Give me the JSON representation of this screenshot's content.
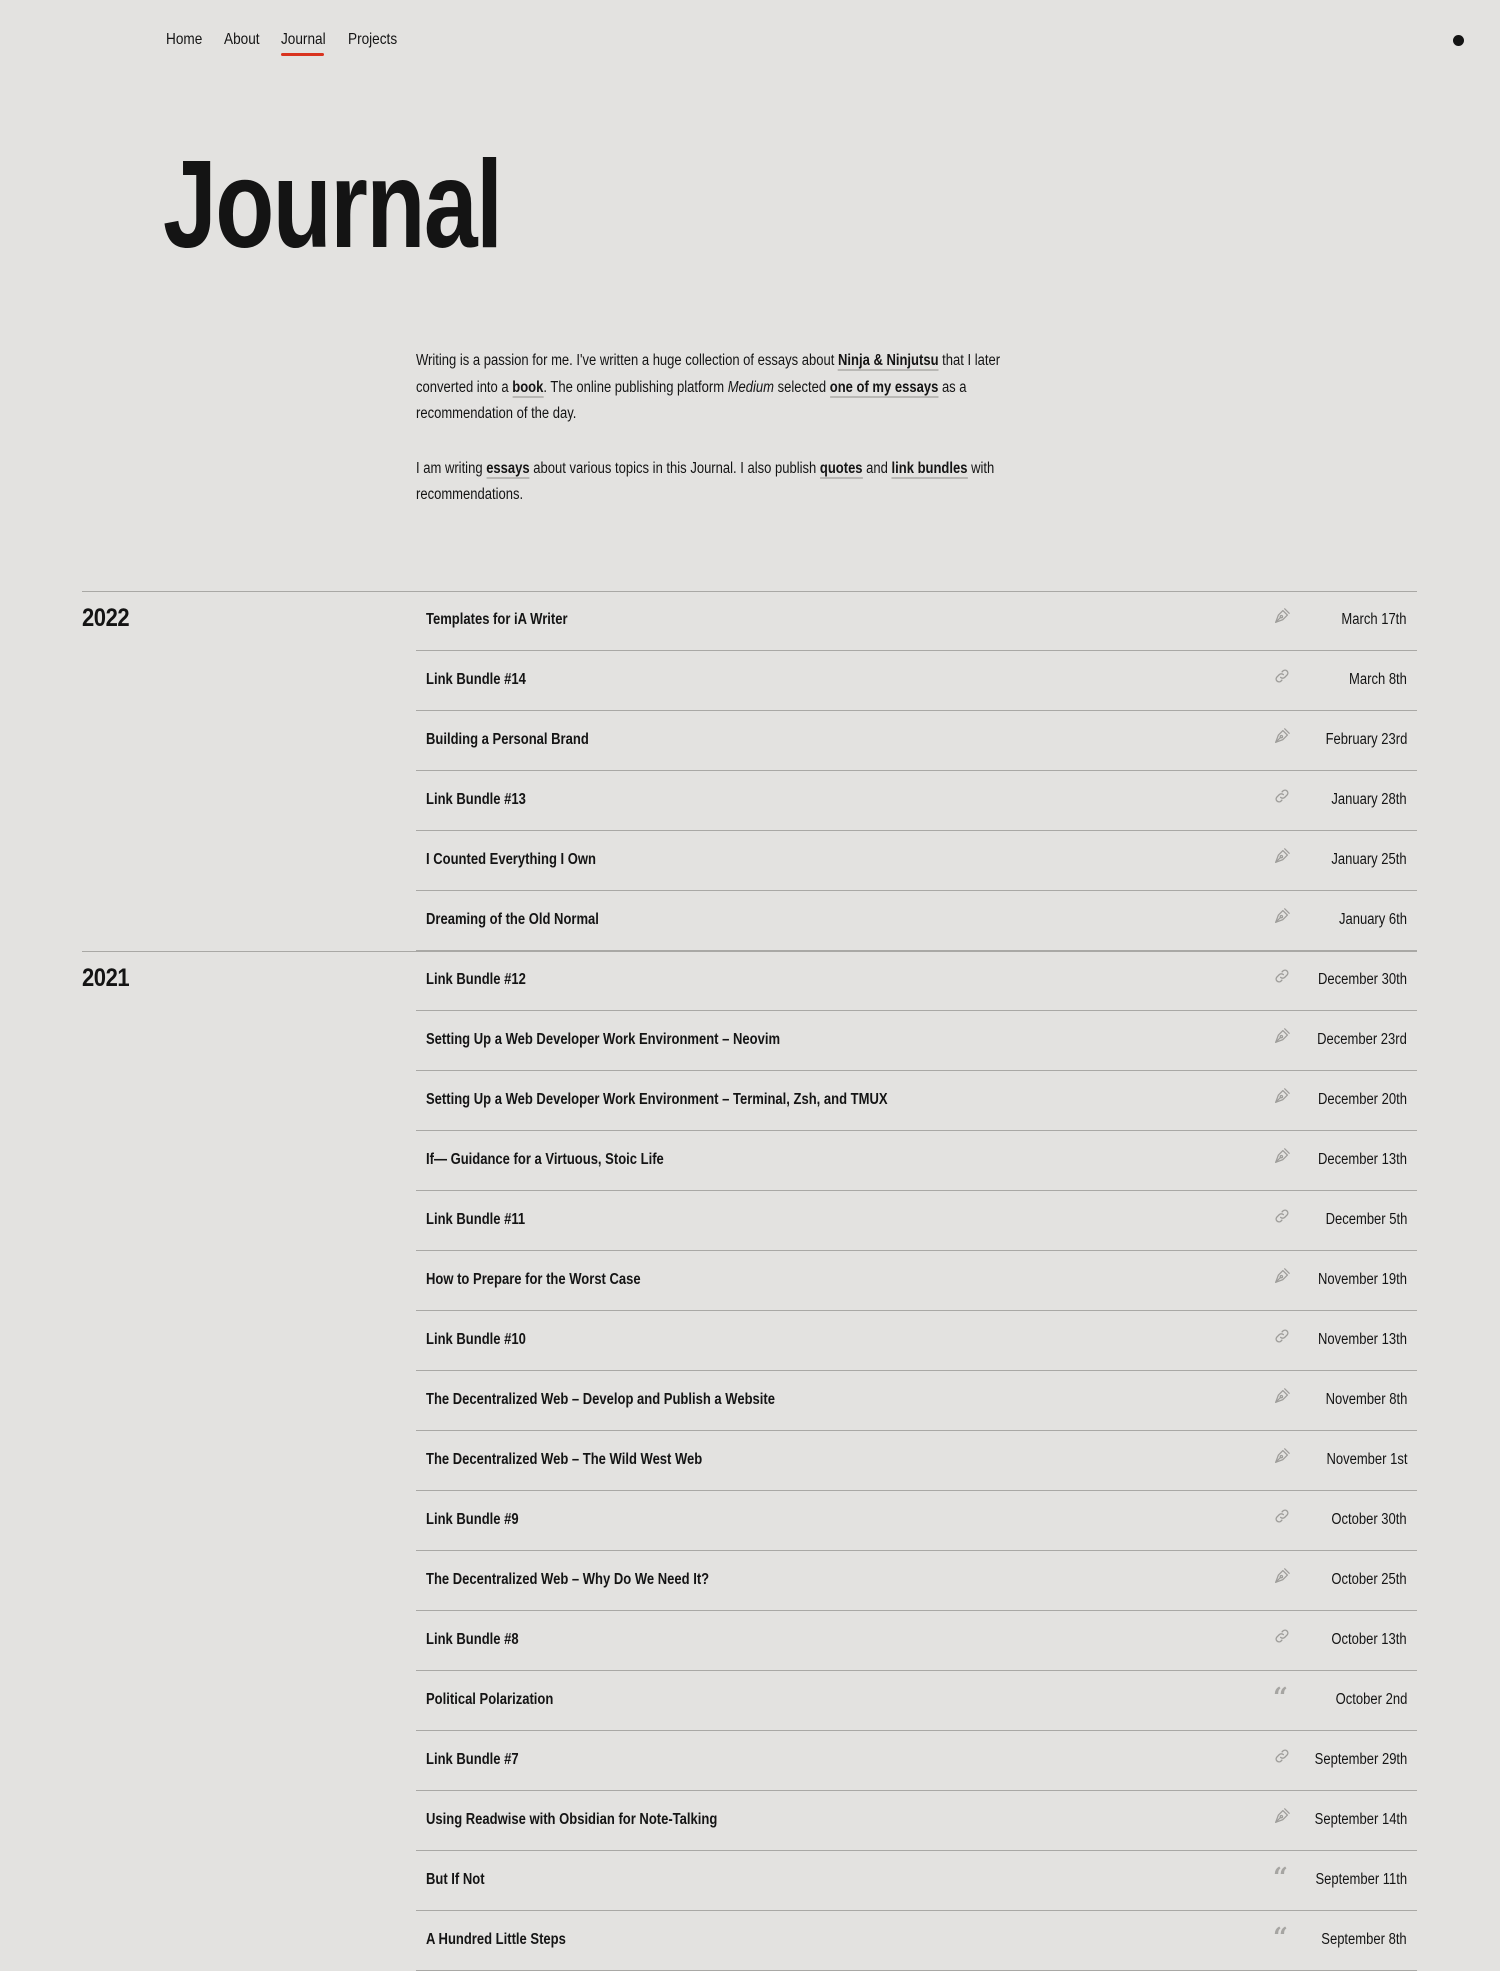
{
  "nav": {
    "items": [
      {
        "label": "Home",
        "active": false
      },
      {
        "label": "About",
        "active": false
      },
      {
        "label": "Journal",
        "active": true
      },
      {
        "label": "Projects",
        "active": false
      }
    ],
    "theme_toggle_icon": "filled-circle-icon"
  },
  "page": {
    "title": "Journal"
  },
  "intro": {
    "p1": [
      {
        "text": "Writing is a passion for me. I've written a huge collection of essays about "
      },
      {
        "text": "Ninja & Ninjutsu",
        "link": true
      },
      {
        "text": " that I later"
      },
      {
        "br": true
      },
      {
        "text": "converted into a "
      },
      {
        "text": "book",
        "link": true
      },
      {
        "text": ". The online publishing platform "
      },
      {
        "text": "Medium",
        "em": true
      },
      {
        "text": " selected "
      },
      {
        "text": "one of my essays",
        "link": true
      },
      {
        "text": " as a"
      },
      {
        "br": true
      },
      {
        "text": "recommendation of the day."
      }
    ],
    "p2": [
      {
        "text": "I am writing "
      },
      {
        "text": "essays",
        "link": true
      },
      {
        "text": " about various topics in this Journal. I also publish "
      },
      {
        "text": "quotes",
        "link": true
      },
      {
        "text": " and "
      },
      {
        "text": "link bundles",
        "link": true
      },
      {
        "text": " with"
      },
      {
        "br": true
      },
      {
        "text": "recommendations."
      }
    ]
  },
  "icon_types": {
    "essay": "pen-nib-icon",
    "link": "link-icon",
    "quote": "quote-icon"
  },
  "years": [
    {
      "year": "2022",
      "entries": [
        {
          "title": "Templates for iA Writer",
          "type": "essay",
          "date": "March 17th"
        },
        {
          "title": "Link Bundle #14",
          "type": "link",
          "date": "March 8th"
        },
        {
          "title": "Building a Personal Brand",
          "type": "essay",
          "date": "February 23rd"
        },
        {
          "title": "Link Bundle #13",
          "type": "link",
          "date": "January 28th"
        },
        {
          "title": "I Counted Everything I Own",
          "type": "essay",
          "date": "January 25th"
        },
        {
          "title": "Dreaming of the Old Normal",
          "type": "essay",
          "date": "January 6th"
        }
      ]
    },
    {
      "year": "2021",
      "entries": [
        {
          "title": "Link Bundle #12",
          "type": "link",
          "date": "December 30th"
        },
        {
          "title": "Setting Up a Web Developer Work Environment – Neovim",
          "type": "essay",
          "date": "December 23rd"
        },
        {
          "title": "Setting Up a Web Developer Work Environment – Terminal, Zsh, and TMUX",
          "type": "essay",
          "date": "December 20th"
        },
        {
          "title": "If— Guidance for a Virtuous, Stoic Life",
          "type": "essay",
          "date": "December 13th"
        },
        {
          "title": "Link Bundle #11",
          "type": "link",
          "date": "December 5th"
        },
        {
          "title": "How to Prepare for the Worst Case",
          "type": "essay",
          "date": "November 19th"
        },
        {
          "title": "Link Bundle #10",
          "type": "link",
          "date": "November 13th"
        },
        {
          "title": "The Decentralized Web – Develop and Publish a Website",
          "type": "essay",
          "date": "November 8th"
        },
        {
          "title": "The Decentralized Web – The Wild West Web",
          "type": "essay",
          "date": "November 1st"
        },
        {
          "title": "Link Bundle #9",
          "type": "link",
          "date": "October 30th"
        },
        {
          "title": "The Decentralized Web – Why Do We Need It?",
          "type": "essay",
          "date": "October 25th"
        },
        {
          "title": "Link Bundle #8",
          "type": "link",
          "date": "October 13th"
        },
        {
          "title": "Political Polarization",
          "type": "quote",
          "date": "October 2nd"
        },
        {
          "title": "Link Bundle #7",
          "type": "link",
          "date": "September 29th"
        },
        {
          "title": "Using Readwise with Obsidian for Note-Talking",
          "type": "essay",
          "date": "September 14th"
        },
        {
          "title": "But If Not",
          "type": "quote",
          "date": "September 11th"
        },
        {
          "title": "A Hundred Little Steps",
          "type": "quote",
          "date": "September 8th"
        }
      ]
    }
  ]
}
